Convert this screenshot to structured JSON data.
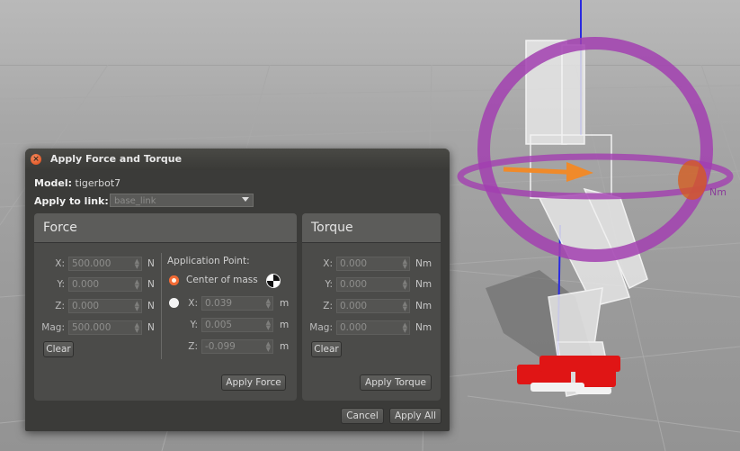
{
  "dialog": {
    "title": "Apply Force and Torque",
    "close_icon": "close-icon",
    "model_label": "Model:",
    "model_value": "tigerbot7",
    "link_label": "Apply to link:",
    "link_value": "base_link"
  },
  "force": {
    "title": "Force",
    "fields": [
      {
        "label": "X:",
        "value": "500.000",
        "unit": "N"
      },
      {
        "label": "Y:",
        "value": "0.000",
        "unit": "N"
      },
      {
        "label": "Z:",
        "value": "0.000",
        "unit": "N"
      },
      {
        "label": "Mag:",
        "value": "500.000",
        "unit": "N"
      }
    ],
    "clear_label": "Clear",
    "application_point": {
      "title": "Application Point:",
      "center_of_mass_label": "Center of mass",
      "fields": [
        {
          "label": "X:",
          "value": "0.039",
          "unit": "m"
        },
        {
          "label": "Y:",
          "value": "0.005",
          "unit": "m"
        },
        {
          "label": "Z:",
          "value": "-0.099",
          "unit": "m"
        }
      ]
    },
    "apply_label": "Apply Force"
  },
  "torque": {
    "title": "Torque",
    "fields": [
      {
        "label": "X:",
        "value": "0.000",
        "unit": "Nm"
      },
      {
        "label": "Y:",
        "value": "0.000",
        "unit": "Nm"
      },
      {
        "label": "Z:",
        "value": "0.000",
        "unit": "Nm"
      },
      {
        "label": "Mag:",
        "value": "0.000",
        "unit": "Nm"
      }
    ],
    "clear_label": "Clear",
    "apply_label": "Apply Torque"
  },
  "footer": {
    "cancel_label": "Cancel",
    "apply_all_label": "Apply All"
  },
  "scene": {
    "torque_ring_label": "Nm",
    "colors": {
      "ring": "#a23fb0",
      "arrow": "#f08a2a",
      "feet": "#e01010",
      "axis": "#2222dd"
    }
  }
}
